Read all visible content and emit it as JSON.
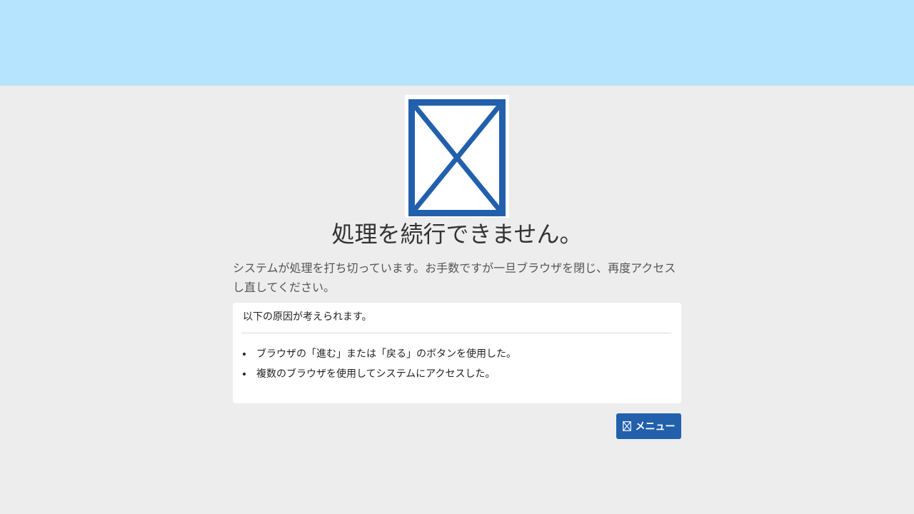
{
  "colors": {
    "top_band": "#b6e3fd",
    "background": "#ededed",
    "accent": "#2260ac",
    "card": "#ffffff"
  },
  "illustration": {
    "icon": "broken-image-icon"
  },
  "error": {
    "title": "処理を続行できません。",
    "description": "システムが処理を打ち切っています。お手数ですが一旦ブラウザを閉じ、再度アクセスし直してください。"
  },
  "causes": {
    "header": "以下の原因が考えられます。",
    "items": [
      "ブラウザの「進む」または「戻る」のボタンを使用した。",
      "複数のブラウザを使用してシステムにアクセスした。"
    ]
  },
  "menu_button": {
    "label": "メニュー",
    "icon": "broken-image-icon"
  }
}
